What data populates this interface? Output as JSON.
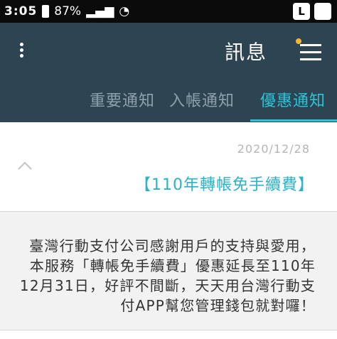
{
  "status_bar": {
    "time": "3:05",
    "battery": "87%",
    "box_l": "L",
    "box_2": ""
  },
  "header": {
    "title": "訊息"
  },
  "tabs": [
    {
      "label": "優惠通知",
      "active": true
    },
    {
      "label": "入帳通知",
      "active": false
    },
    {
      "label": "重要通知",
      "active": false
    }
  ],
  "message": {
    "date": "2020/12/28",
    "title": "【110年轉帳免手續費】",
    "body_lines": [
      "臺灣行動支付公司感謝用戶的支持與愛用，",
      "本服務「轉帳免手續費」優惠延長至110年",
      "12月31日，好評不間斷，天天用台灣行動支",
      "付APP幫您管理錢包就對囉！"
    ]
  },
  "colors": {
    "header_bg": "#2d4452",
    "accent": "#29c4d8"
  }
}
